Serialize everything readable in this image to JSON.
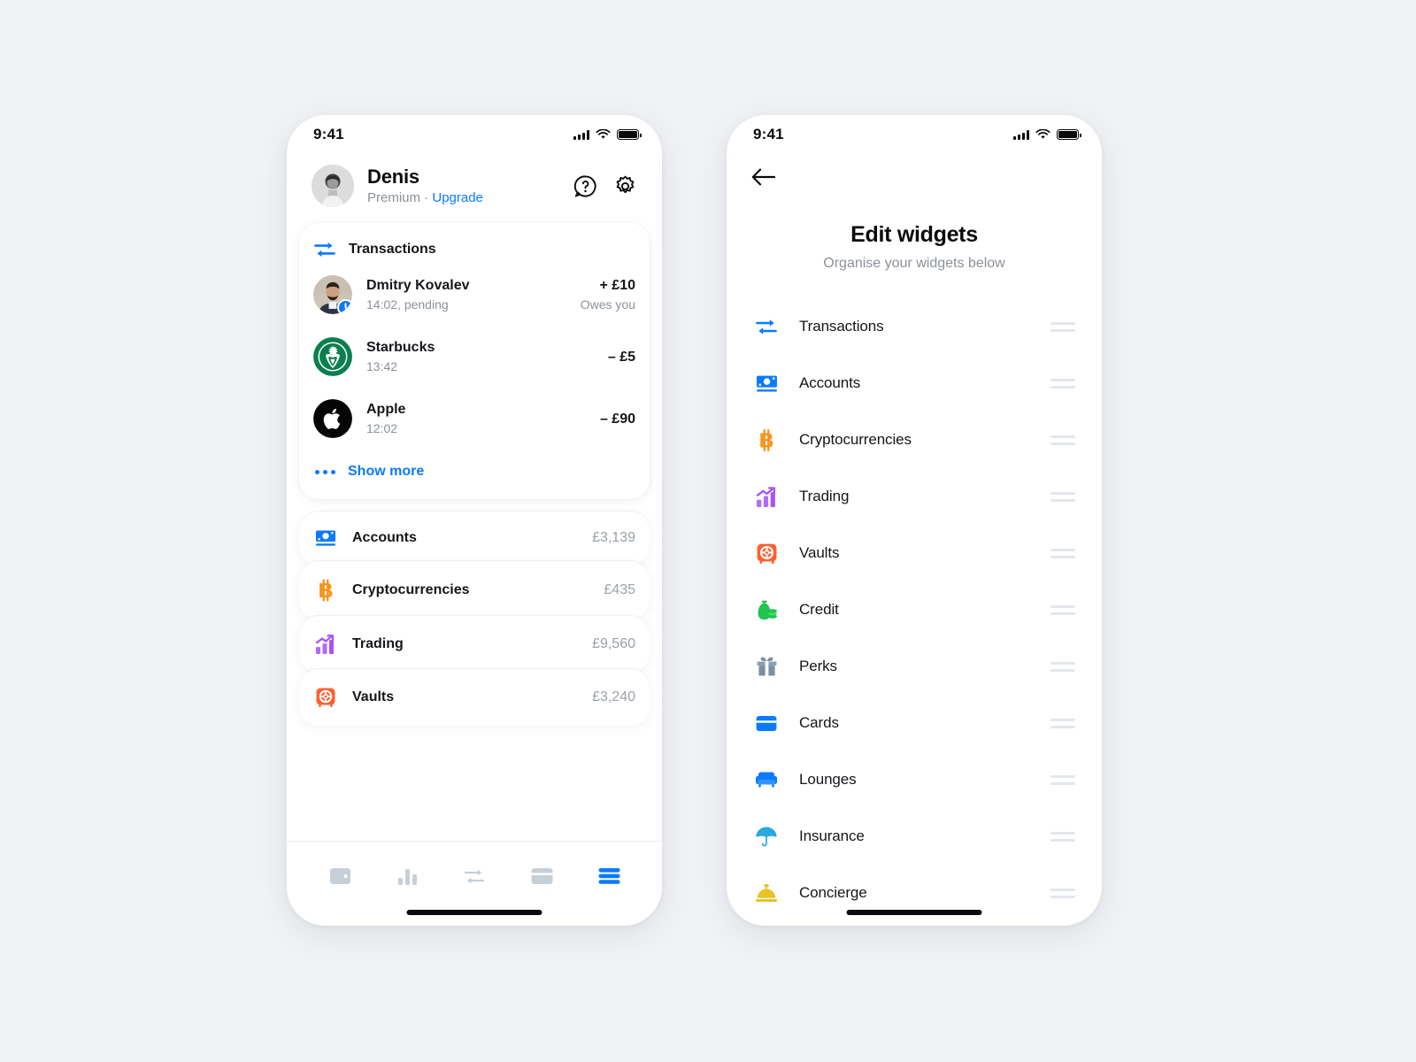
{
  "colors": {
    "page_bg": "#f0f2f5",
    "accent_blue": "#0a7aff",
    "muted_text": "#8b9199",
    "primary_text": "#15161a",
    "orange": "#f7931a",
    "purple": "#a855f7",
    "vault_orange": "#ff5f2e",
    "green": "#21c44d",
    "slate": "#7b8fa3",
    "yellow": "#e8c227",
    "cyan": "#2aa8e0"
  },
  "phone_left": {
    "status_bar": {
      "time": "9:41",
      "signal_icon": "cellular-signal-icon",
      "wifi_icon": "wifi-icon",
      "battery_icon": "battery-icon"
    },
    "profile": {
      "avatar_icon": "user-avatar",
      "name": "Denis",
      "plan": "Premium",
      "separator": "·",
      "upgrade_label": "Upgrade",
      "help_icon": "help-icon",
      "settings_icon": "gear-icon"
    },
    "transactions_card": {
      "icon": "transfer-arrows-icon",
      "title": "Transactions",
      "rows": [
        {
          "avatar": "person-photo-avatar",
          "badge": "clock-icon",
          "name": "Dmitry Kovalev",
          "meta": "14:02, pending",
          "amount": "+ £10",
          "note": "Owes you"
        },
        {
          "avatar": "starbucks-logo",
          "badge": "",
          "name": "Starbucks",
          "meta": "13:42",
          "amount": "– £5",
          "note": ""
        },
        {
          "avatar": "apple-logo",
          "badge": "",
          "name": "Apple",
          "meta": "12:02",
          "amount": "– £90",
          "note": ""
        }
      ],
      "show_more": {
        "icon": "more-dots-icon",
        "label": "Show more"
      }
    },
    "accounts_stack": [
      {
        "icon": "banknote-icon",
        "label": "Accounts",
        "value": "£3,139"
      },
      {
        "icon": "bitcoin-icon",
        "label": "Cryptocurrencies",
        "value": "£435"
      },
      {
        "icon": "trading-chart-icon",
        "label": "Trading",
        "value": "£9,560"
      },
      {
        "icon": "vault-icon",
        "label": "Vaults",
        "value": "£3,240"
      }
    ],
    "tabbar": [
      {
        "icon": "wallet-icon",
        "active": false
      },
      {
        "icon": "analytics-bars-icon",
        "active": false
      },
      {
        "icon": "transfer-arrows-icon",
        "active": false
      },
      {
        "icon": "card-icon",
        "active": false
      },
      {
        "icon": "widgets-list-icon",
        "active": true
      }
    ]
  },
  "phone_right": {
    "status_bar": {
      "time": "9:41",
      "signal_icon": "cellular-signal-icon",
      "wifi_icon": "wifi-icon",
      "battery_icon": "battery-icon"
    },
    "back_icon": "back-arrow-icon",
    "title": "Edit widgets",
    "subtitle": "Organise your widgets below",
    "widgets": [
      {
        "icon": "transfer-arrows-icon",
        "label": "Transactions",
        "handle": "drag-handle-icon"
      },
      {
        "icon": "banknote-icon",
        "label": "Accounts",
        "handle": "drag-handle-icon"
      },
      {
        "icon": "bitcoin-icon",
        "label": "Cryptocurrencies",
        "handle": "drag-handle-icon"
      },
      {
        "icon": "trading-chart-icon",
        "label": "Trading",
        "handle": "drag-handle-icon"
      },
      {
        "icon": "vault-icon",
        "label": "Vaults",
        "handle": "drag-handle-icon"
      },
      {
        "icon": "money-bag-icon",
        "label": "Credit",
        "handle": "drag-handle-icon"
      },
      {
        "icon": "gift-icon",
        "label": "Perks",
        "handle": "drag-handle-icon"
      },
      {
        "icon": "card-icon",
        "label": "Cards",
        "handle": "drag-handle-icon"
      },
      {
        "icon": "armchair-icon",
        "label": "Lounges",
        "handle": "drag-handle-icon"
      },
      {
        "icon": "umbrella-icon",
        "label": "Insurance",
        "handle": "drag-handle-icon"
      },
      {
        "icon": "service-bell-icon",
        "label": "Concierge",
        "handle": "drag-handle-icon"
      }
    ]
  }
}
